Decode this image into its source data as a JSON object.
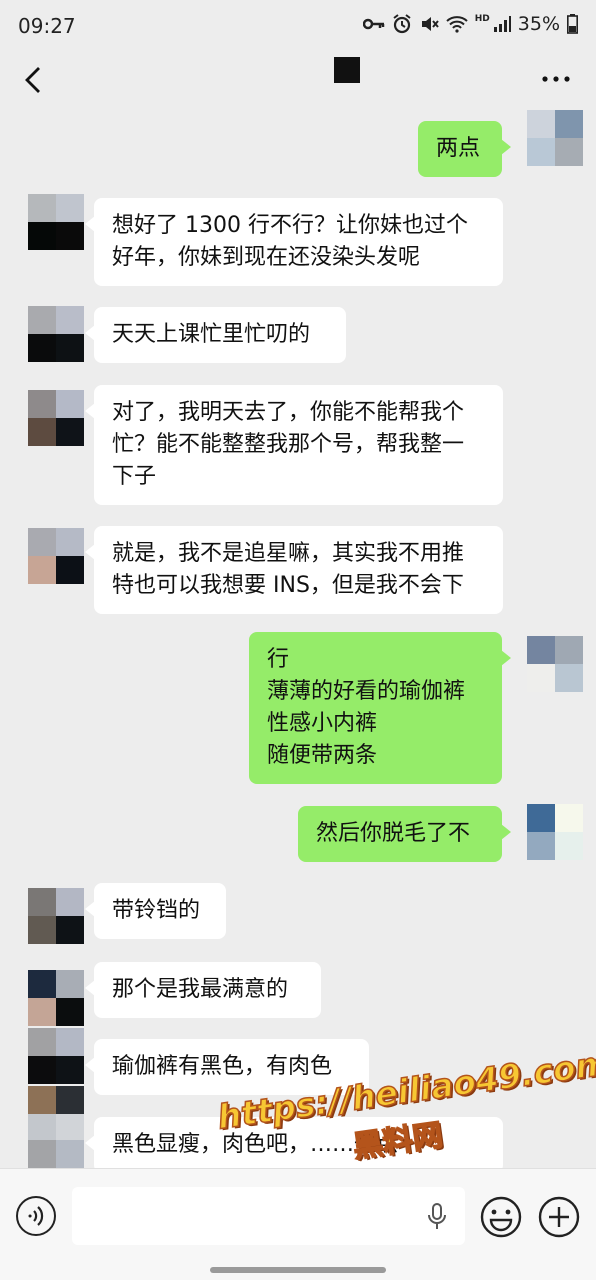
{
  "status_bar": {
    "time": "09:27",
    "hd_label": "HD",
    "battery": "35%",
    "icons": [
      "key-icon",
      "alarm-icon",
      "mute-icon",
      "wifi-icon",
      "signal-icon",
      "battery-icon"
    ]
  },
  "header": {
    "back_icon": "back-arrow-icon",
    "title_redacted": true,
    "more_icon": "more-icon"
  },
  "messages": [
    {
      "side": "right",
      "text": "两点",
      "avatar_colors": [
        "#cdd3dc",
        "#7f95ad",
        "#b9c8d6",
        "#a6acb3"
      ]
    },
    {
      "side": "left",
      "text": "想好了 1300 行不行？让你妹也过个\n好年，你妹到现在还没染头发呢",
      "avatar_colors": [
        "#b5b8bb",
        "#c0c5ce",
        "#050807",
        "#0a0a0a"
      ]
    },
    {
      "side": "left",
      "text": "天天上课忙里忙叨的",
      "avatar_colors": [
        "#a9aaae",
        "#b9bdc9",
        "#0a0b0c",
        "#0d1114"
      ]
    },
    {
      "side": "left",
      "text": "对了，我明天去了，你能不能帮我个\n忙？能不能整整我那个号，帮我整一\n下子",
      "avatar_colors": [
        "#8e8a8b",
        "#b4b9c7",
        "#5d4b40",
        "#0f1318"
      ]
    },
    {
      "side": "left",
      "text": "就是，我不是追星嘛，其实我不用推\n特也可以我想要 INS，但是我不会下",
      "avatar_colors": [
        "#a9aab0",
        "#b5bac6",
        "#c7a595",
        "#0c1016"
      ]
    },
    {
      "side": "right",
      "text": "行\n薄薄的好看的瑜伽裤\n性感小内裤\n随便带两条",
      "avatar_colors": [
        "#7485a0",
        "#9fa8b3",
        "#eeeeec",
        "#b9c6d2"
      ]
    },
    {
      "side": "right",
      "text": "然后你脱毛了不",
      "avatar_colors": [
        "#3f6a97",
        "#f6f8ec",
        "#93a9bf",
        "#e6f0ec"
      ]
    },
    {
      "side": "left",
      "text": "带铃铛的",
      "avatar_colors": [
        "#7a7775",
        "#b3b7c4",
        "#615a52",
        "#0e1216"
      ]
    },
    {
      "side": "left",
      "text": "那个是我最满意的",
      "avatar_colors": [
        "#1d2a3e",
        "#a8adb5",
        "#c4a596",
        "#0b0d0e"
      ]
    },
    {
      "side": "left",
      "text": "瑜伽裤有黑色，有肉色",
      "avatar_colors": [
        "#a1a1a3",
        "#b3b8c5",
        "#0c0c0d",
        "#0e1216"
      ]
    },
    {
      "side": "left",
      "text": "",
      "avatar_colors": [
        "#8d7156",
        "#2b2f34",
        "#c3c7cc",
        "#d1d4d8"
      ]
    },
    {
      "side": "left",
      "text": "黑色显瘦，肉色吧，……一点",
      "avatar_colors": [
        "#a3a4a7",
        "#b4bac4",
        "#0b0c0d",
        "#0d1116"
      ]
    }
  ],
  "watermark": {
    "url": "https://heiliao49.com",
    "name": "黑料网"
  },
  "input_bar": {
    "placeholder": "",
    "voice_icon": "voice-icon",
    "mic_icon": "mic-icon",
    "emoji_icon": "emoji-icon",
    "plus_icon": "plus-icon"
  }
}
